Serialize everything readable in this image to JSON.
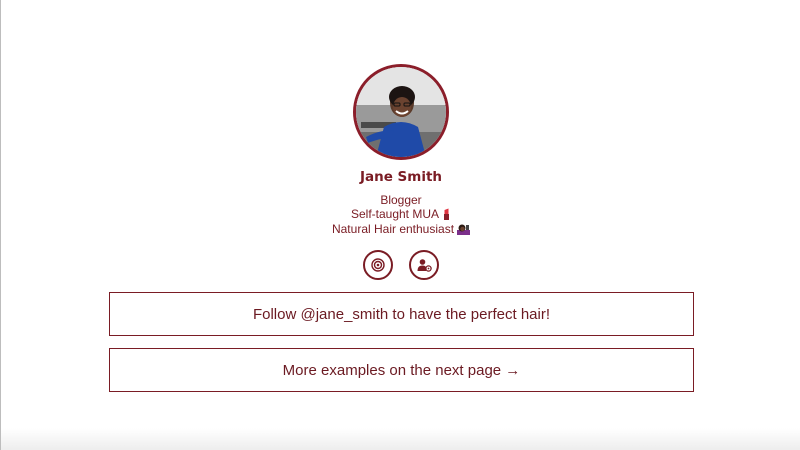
{
  "profile": {
    "name": "Jane Smith",
    "avatar_alt": "profile photo",
    "bio": [
      {
        "text": "Blogger",
        "emoji": ""
      },
      {
        "text": "Self-taught MUA",
        "emoji": "lipstick-icon"
      },
      {
        "text": "Natural Hair enthusiast",
        "emoji": "haircut-icon"
      }
    ]
  },
  "socials": [
    {
      "icon": "target-icon"
    },
    {
      "icon": "person-settings-icon"
    }
  ],
  "links": {
    "follow_label": "Follow @jane_smith to have the perfect hair!",
    "next_label": "More examples on the next page →"
  },
  "colors": {
    "accent": "#7a1c24",
    "avatar_ring": "#8b1e2a"
  }
}
